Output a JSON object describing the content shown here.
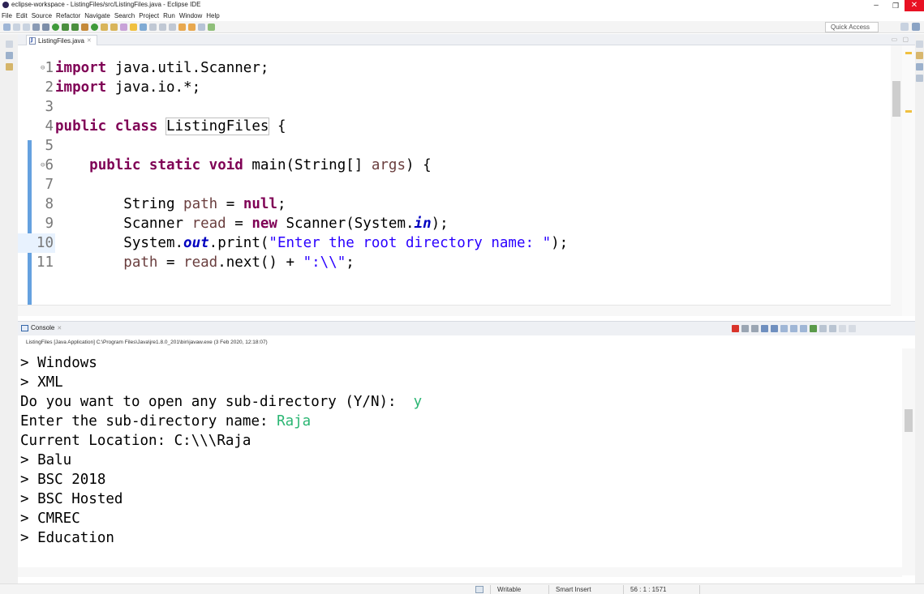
{
  "window": {
    "title": "eclipse-workspace - ListingFiles/src/ListingFiles.java - Eclipse IDE",
    "minimize": "–",
    "maximize": "❐",
    "close": "✕"
  },
  "menu": [
    "File",
    "Edit",
    "Source",
    "Refactor",
    "Navigate",
    "Search",
    "Project",
    "Run",
    "Window",
    "Help"
  ],
  "toolbar": {
    "quick_access": "Quick Access"
  },
  "editor": {
    "tab_label": "ListingFiles.java",
    "tab_close": "✕",
    "view_controls": "▭ ▢",
    "lines": [
      {
        "n": "1",
        "fold": "⊖"
      },
      {
        "n": "2",
        "fold": ""
      },
      {
        "n": "3",
        "fold": ""
      },
      {
        "n": "4",
        "fold": ""
      },
      {
        "n": "5",
        "fold": ""
      },
      {
        "n": "6",
        "fold": "⊖"
      },
      {
        "n": "7",
        "fold": ""
      },
      {
        "n": "8",
        "fold": ""
      },
      {
        "n": "9",
        "fold": ""
      },
      {
        "n": "10",
        "fold": ""
      },
      {
        "n": "11",
        "fold": ""
      }
    ],
    "code": {
      "l1_kw": "import",
      "l1_rest": " java.util.Scanner;",
      "l2_kw": "import",
      "l2_rest": " java.io.*;",
      "l4_kw": "public class",
      "l4_name": "ListingFiles",
      "l4_rest": " {",
      "l6_indent": "    ",
      "l6_kw": "public static void",
      "l6_rest": " main(String[] ",
      "l6_var": "args",
      "l6_end": ") {",
      "l8_a": "        String ",
      "l8_var": "path",
      "l8_b": " = ",
      "l8_kw": "null",
      "l8_c": ";",
      "l9_a": "        Scanner ",
      "l9_var": "read",
      "l9_b": " = ",
      "l9_kw": "new",
      "l9_c": " Scanner(System.",
      "l9_static": "in",
      "l9_d": ");",
      "l10_a": "        System.",
      "l10_static": "out",
      "l10_b": ".print(",
      "l10_str": "\"Enter the root directory name: \"",
      "l10_c": ");",
      "l11_a": "        ",
      "l11_var": "path",
      "l11_b": " = ",
      "l11_var2": "read",
      "l11_c": ".next() + ",
      "l11_str": "\":\\\\\"",
      "l11_d": ";"
    }
  },
  "console": {
    "tab_label": "Console",
    "tab_close": "✕",
    "info": "ListingFiles [Java Application] C:\\Program Files\\Java\\jre1.8.0_201\\bin\\javaw.exe (3 Feb 2020, 12:18:07)",
    "lines": [
      {
        "text": "> Windows",
        "input": ""
      },
      {
        "text": "> XML",
        "input": ""
      },
      {
        "text": "Do you want to open any sub-directory (Y/N):  ",
        "input": "y"
      },
      {
        "text": "Enter the sub-directory name: ",
        "input": "Raja"
      },
      {
        "text": "Current Location: C:\\\\\\Raja",
        "input": ""
      },
      {
        "text": "> Balu",
        "input": ""
      },
      {
        "text": "> BSC 2018",
        "input": ""
      },
      {
        "text": "> BSC Hosted",
        "input": ""
      },
      {
        "text": "> CMREC",
        "input": ""
      },
      {
        "text": "> Education",
        "input": ""
      }
    ]
  },
  "status": {
    "writable": "Writable",
    "insert_mode": "Smart Insert",
    "position": "56 : 1 : 1571"
  },
  "colors": {
    "keyword": "#7f0055",
    "string": "#2a00ff",
    "local_var": "#6a3e3e",
    "console_input": "#2bb673",
    "close_button": "#e81123"
  }
}
